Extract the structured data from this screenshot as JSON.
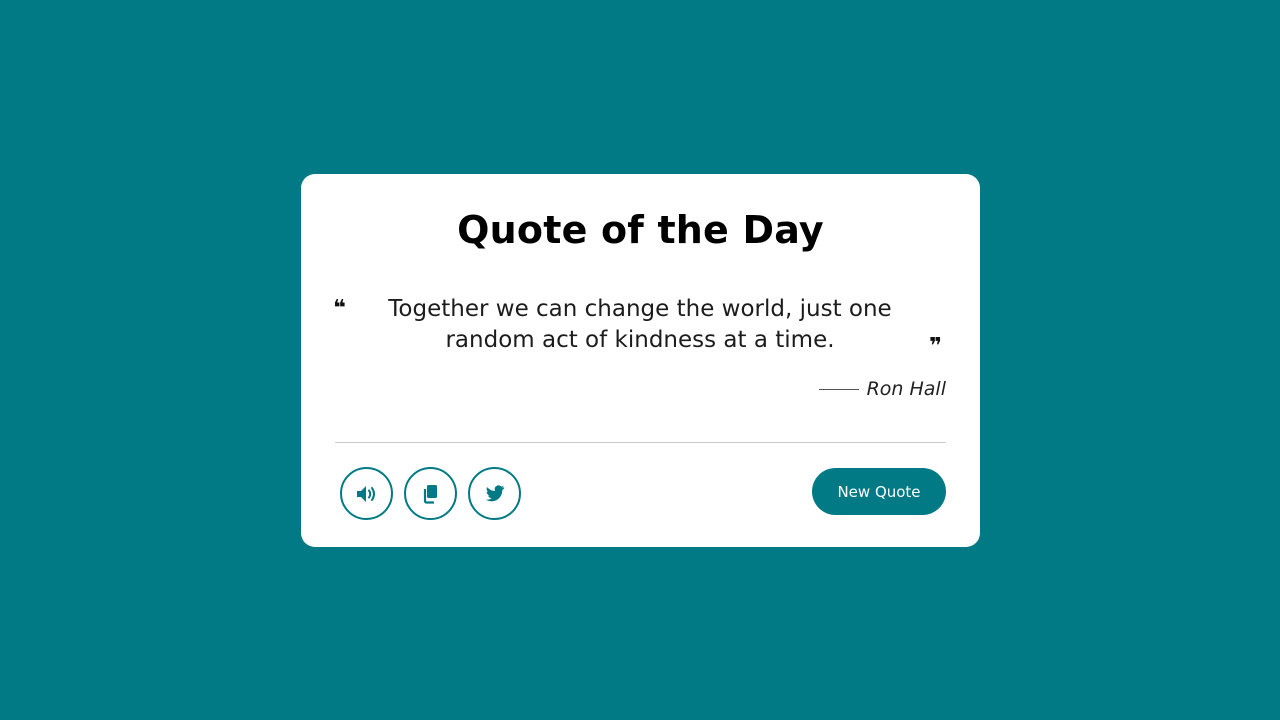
{
  "page": {
    "background_color": "#017a85"
  },
  "card": {
    "title": "Quote of the Day",
    "quote_open_mark": "❝",
    "quote_text": "Together we can change the world, just one random act of kindness at a time.",
    "quote_close_mark": "❞",
    "author": "Ron Hall"
  },
  "actions": {
    "speak_icon": "speaker-icon",
    "copy_icon": "copy-icon",
    "tweet_icon": "twitter-icon",
    "new_quote_label": "New Quote",
    "accent_color": "#017a85"
  }
}
